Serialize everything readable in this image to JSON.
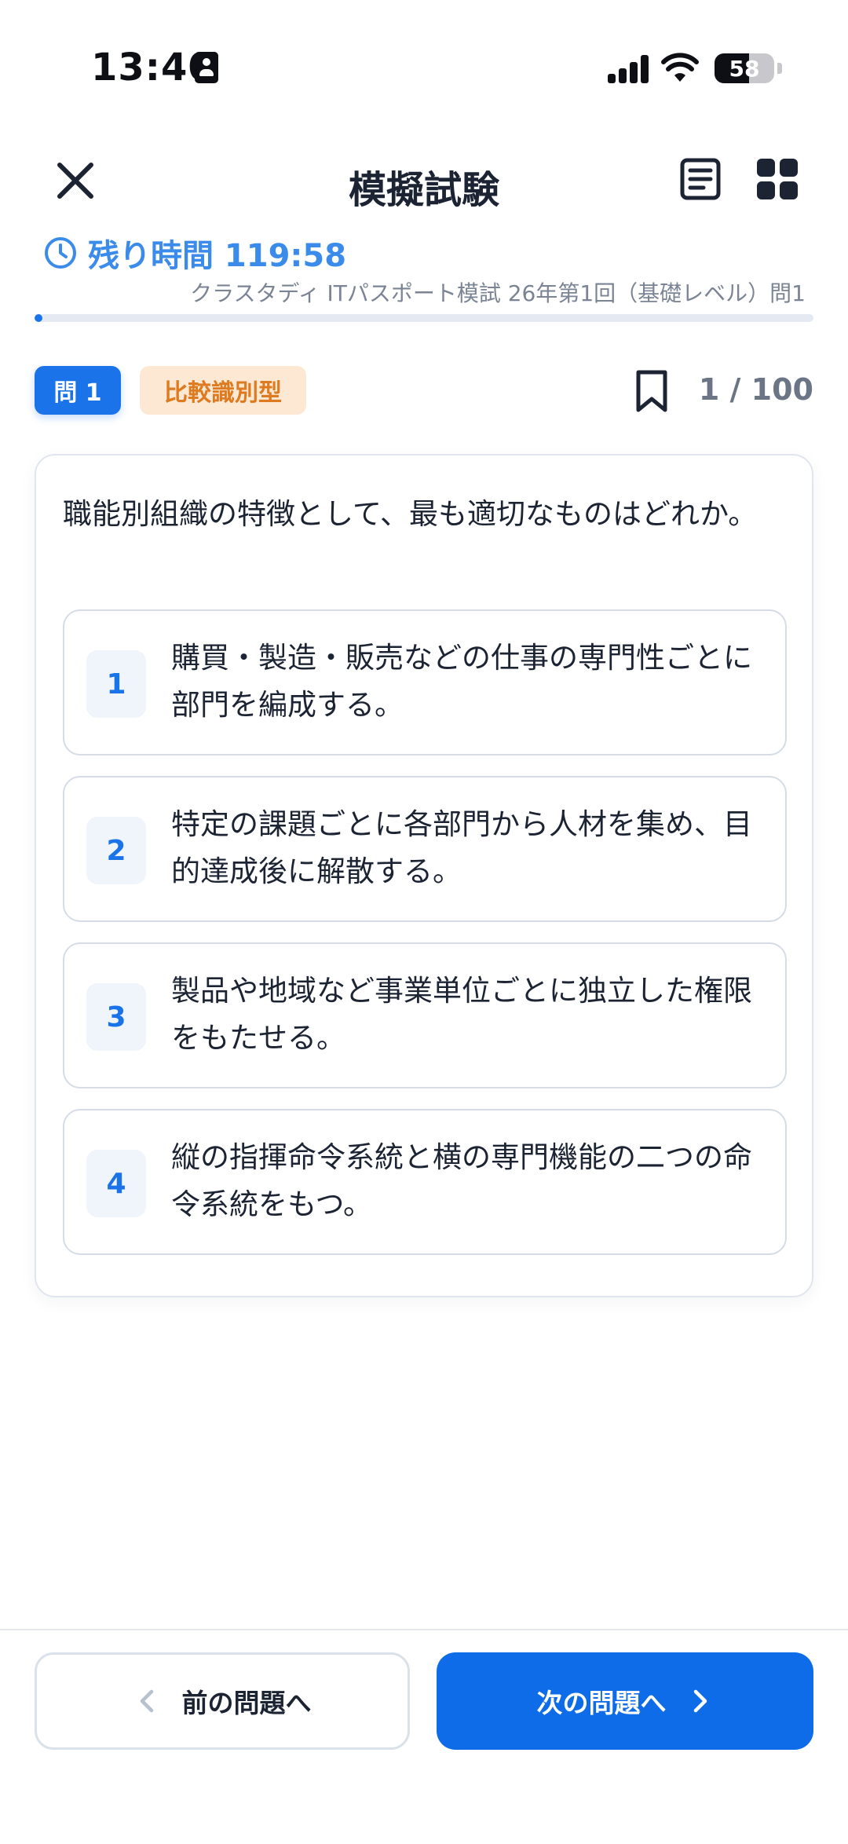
{
  "status_bar": {
    "time": "13:40",
    "battery": "58",
    "battery_level": 0.58,
    "icons": [
      "contact-card-icon",
      "cellular-signal-icon",
      "wifi-icon",
      "battery-icon"
    ]
  },
  "header": {
    "title": "模擬試験",
    "icons": [
      "close-icon",
      "list-icon",
      "grid-icon"
    ]
  },
  "timer": {
    "label": "残り時間 119:58",
    "icon": "clock-icon"
  },
  "exam": {
    "caption": "クラスタディ ITパスポート模試 26年第1回（基礎レベル）問1",
    "progress": 0.01
  },
  "question_meta": {
    "badge": "問 1",
    "type_tag": "比較識別型",
    "counter": "1 / 100",
    "bookmark_icon": "bookmark-icon"
  },
  "question": {
    "text": "職能別組織の特徴として、最も適切なものはどれか。",
    "options": [
      {
        "number": "1",
        "text": "購買・製造・販売などの仕事の専門性ごとに部門を編成する。"
      },
      {
        "number": "2",
        "text": "特定の課題ごとに各部門から人材を集め、目的達成後に解散する。"
      },
      {
        "number": "3",
        "text": "製品や地域など事業単位ごとに独立した権限をもたせる。"
      },
      {
        "number": "4",
        "text": "縦の指揮命令系統と横の専門機能の二つの命令系統をもつ。"
      }
    ]
  },
  "navigation": {
    "prev_label": "前の問題へ",
    "next_label": "次の問題へ"
  },
  "colors": {
    "primary": "#1a73e8",
    "timer": "#3b8beb",
    "tag_bg": "#fde8d4",
    "tag_text": "#de7a1f",
    "text": "#1c2434",
    "muted": "#7b8494"
  }
}
